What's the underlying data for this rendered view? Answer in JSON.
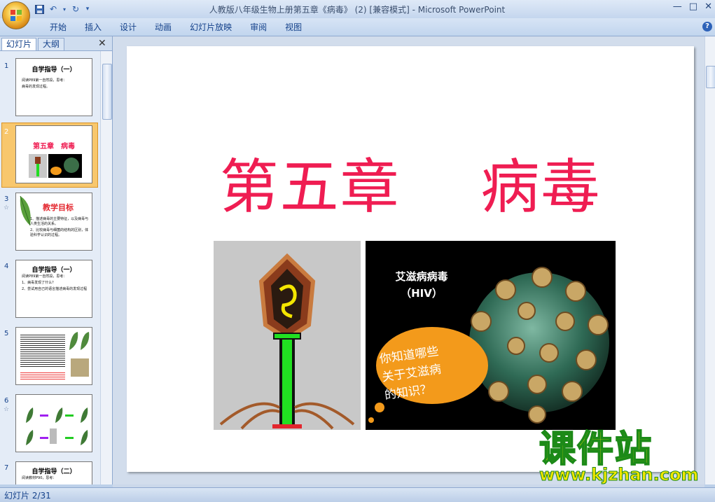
{
  "window": {
    "title": "人教版八年级生物上册第五章《病毒》 (2) [兼容模式] - Microsoft PowerPoint",
    "controls": [
      "—",
      "□",
      "✕"
    ]
  },
  "ribbon": {
    "tabs": [
      "开始",
      "插入",
      "设计",
      "动画",
      "幻灯片放映",
      "审阅",
      "视图"
    ],
    "help": "?"
  },
  "panel": {
    "tabs": [
      "幻灯片",
      "大纲"
    ],
    "close": "✕",
    "thumbnails": [
      {
        "num": "1",
        "title": "自学指导（一）",
        "lines": [
          "阅读P89第一自然段，思考：",
          "病毒的发现过程。"
        ]
      },
      {
        "num": "2",
        "title": "第五章　病毒"
      },
      {
        "num": "3",
        "title": "教学目标",
        "lines": [
          "1、描述病毒的主要特征，以及病毒与人类生活的关系。",
          "2、比较病毒与细菌的结构的区别，体验科学认识的过程。"
        ]
      },
      {
        "num": "4",
        "title": "自学指导（一）",
        "lines": [
          "阅读P89第一自然段，思考：",
          "1、病毒发现了什么？",
          "2、尝试用自己的语言描述病毒的发现过程"
        ]
      },
      {
        "num": "5"
      },
      {
        "num": "6"
      },
      {
        "num": "7",
        "title": "自学指导（二）",
        "lines": [
          "阅读教材P90，思考："
        ]
      }
    ],
    "anim_icon": "☆"
  },
  "slide": {
    "title": "第五章　 病毒",
    "hiv_label_line1": "艾滋病病毒",
    "hiv_label_line2": "（HIV）",
    "bubble_line1": "你知道哪些",
    "bubble_line2": "关于艾滋病",
    "bubble_line3": "的知识？"
  },
  "status": {
    "slide_indicator": "幻灯片 2/31"
  },
  "watermark": {
    "brand": "课件站",
    "url": "www.kjzhan.com"
  },
  "colors": {
    "title_red": "#ef1d52",
    "selection": "#f8c76d",
    "watermark_yellow": "#f2e600"
  }
}
